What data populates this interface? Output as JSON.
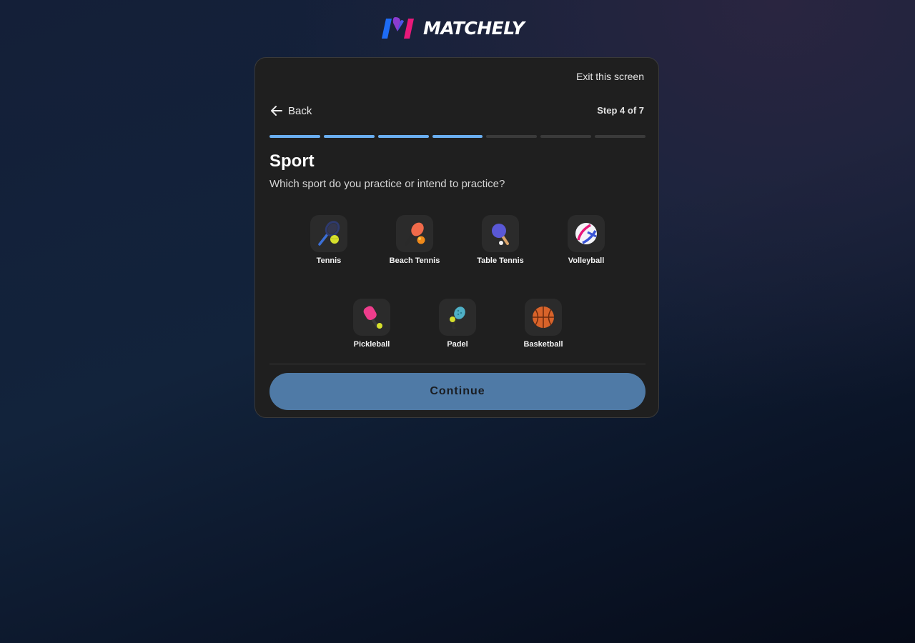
{
  "brand": {
    "name": "MATCHELY",
    "colors": {
      "blue": "#1e6cf5",
      "purple": "#8b3ccf",
      "pink": "#e8197a"
    }
  },
  "header": {
    "exit_label": "Exit this screen",
    "back_label": "Back",
    "step_label": "Step 4 of 7"
  },
  "progress": {
    "current": 4,
    "total": 7,
    "active_color": "#6aaef0"
  },
  "question": {
    "title": "Sport",
    "subtitle": "Which sport do you practice or intend to practice?"
  },
  "sports": [
    {
      "label": "Tennis",
      "icon": "tennis-racket-icon"
    },
    {
      "label": "Beach Tennis",
      "icon": "beach-tennis-paddle-icon"
    },
    {
      "label": "Table Tennis",
      "icon": "ping-pong-paddle-icon"
    },
    {
      "label": "Volleyball",
      "icon": "volleyball-icon"
    },
    {
      "label": "Pickleball",
      "icon": "pickleball-paddle-icon"
    },
    {
      "label": "Padel",
      "icon": "padel-racket-icon"
    },
    {
      "label": "Basketball",
      "icon": "basketball-icon"
    }
  ],
  "actions": {
    "continue_label": "Continue"
  }
}
